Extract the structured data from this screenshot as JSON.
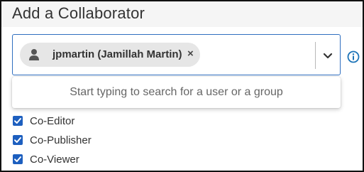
{
  "dialog": {
    "title": "Add a Collaborator"
  },
  "selector": {
    "selected_chip": {
      "label": "jpmartin (Jamillah Martin)",
      "icon": "user-icon",
      "remove_glyph": "×"
    },
    "dropdown_icon": "chevron-down-icon",
    "info_icon": "info-icon",
    "hint": "Start typing to search for a user or a group"
  },
  "roles": [
    {
      "label": "Co-Editor",
      "checked": true
    },
    {
      "label": "Co-Publisher",
      "checked": true
    },
    {
      "label": "Co-Viewer",
      "checked": true
    }
  ],
  "colors": {
    "accent": "#2f6fc0",
    "checkbox": "#1d5fbf",
    "info": "#1d74b8"
  }
}
